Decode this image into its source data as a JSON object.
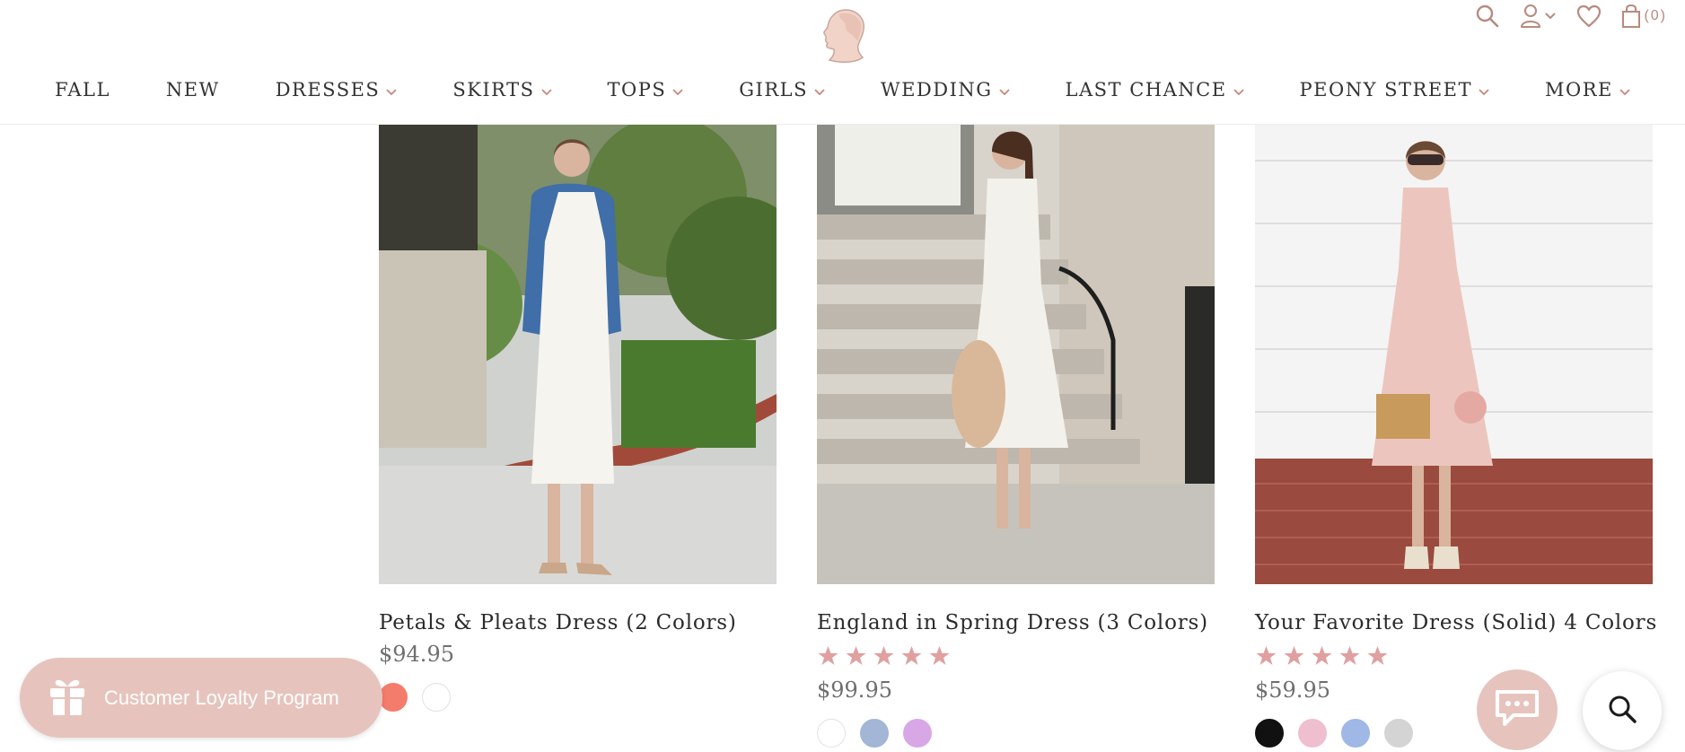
{
  "header": {
    "cart_count": "(0)",
    "icons": [
      "search-icon",
      "account-icon",
      "chevron-down-icon",
      "heart-icon",
      "cart-icon"
    ]
  },
  "nav": {
    "items": [
      {
        "label": "FALL",
        "has_dropdown": false
      },
      {
        "label": "NEW",
        "has_dropdown": false
      },
      {
        "label": "DRESSES",
        "has_dropdown": true
      },
      {
        "label": "SKIRTS",
        "has_dropdown": true
      },
      {
        "label": "TOPS",
        "has_dropdown": true
      },
      {
        "label": "GIRLS",
        "has_dropdown": true
      },
      {
        "label": "WEDDING",
        "has_dropdown": true
      },
      {
        "label": "LAST CHANCE",
        "has_dropdown": true
      },
      {
        "label": "PEONY STREET",
        "has_dropdown": true
      },
      {
        "label": "MORE",
        "has_dropdown": true
      }
    ]
  },
  "products": [
    {
      "name": "Petals & Pleats Dress (2 Colors)",
      "price": "$94.95",
      "rating": null,
      "swatches": [
        "#f47c6c",
        "#ffffff"
      ]
    },
    {
      "name": "England in Spring Dress (3 Colors)",
      "price": "$99.95",
      "rating": 5,
      "swatches": [
        "#ffffff",
        "#a3b6d6",
        "#d8a8e6"
      ]
    },
    {
      "name": "Your Favorite Dress (Solid) 4 Colors",
      "price": "$59.95",
      "rating": 5,
      "swatches": [
        "#111111",
        "#efbfcf",
        "#9fb8e6",
        "#d4d4d4"
      ]
    }
  ],
  "loyalty": {
    "label": "Customer Loyalty Program",
    "icon": "gift-icon"
  },
  "chat": {
    "icon": "chat-icon"
  },
  "search_fab": {
    "icon": "search-icon"
  },
  "colors": {
    "accent": "#c9877b",
    "star": "#e0a0a0",
    "loyalty_bg": "#e6c4bd",
    "icon": "#b88a7e"
  }
}
